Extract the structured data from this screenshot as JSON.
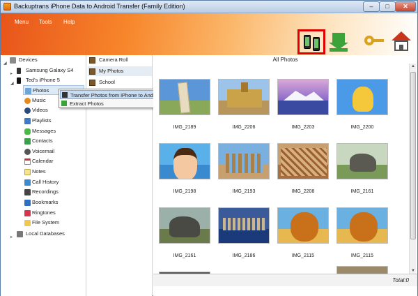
{
  "window": {
    "title": "Backuptrans iPhone Data to Android Transfer (Family Edition)",
    "controls": {
      "minimize": "–",
      "maximize": "□",
      "close": "✕"
    }
  },
  "menu": [
    "Menu",
    "Tools",
    "Help"
  ],
  "toolbar": {
    "icons": [
      "phone-transfer-icon",
      "download-icon",
      "key-icon",
      "home-icon"
    ],
    "highlight_color": "#e00000"
  },
  "tree": {
    "devices_label": "Devices",
    "device1": "Samsung Galaxy S4",
    "device2": "Ted's iPhone 5",
    "items": [
      "Photos",
      "Music",
      "Videos",
      "Playlists",
      "Messages",
      "Contacts",
      "Voicemail",
      "Calendar",
      "Notes",
      "Call History",
      "Recordings",
      "Bookmarks",
      "Ringtones",
      "File System"
    ],
    "local_db": "Local Databases"
  },
  "categories": [
    "Camera Roll",
    "My Photos",
    "School"
  ],
  "context_menu": [
    "Transfer Photos from iPhone to Android",
    "Extract Photos"
  ],
  "content": {
    "title": "All Photos",
    "photos": [
      "IMG_2189",
      "IMG_2206",
      "IMG_2203",
      "IMG_2200",
      "IMG_2198",
      "IMG_2193",
      "IMG_2208",
      "IMG_2161",
      "IMG_2161",
      "IMG_2186",
      "IMG_2115",
      "IMG_2115"
    ]
  },
  "status": {
    "total": "Total:0"
  },
  "colors": {
    "banner_start": "#e8541a",
    "banner_end": "#ffffff",
    "selection": "#dce9f6"
  }
}
